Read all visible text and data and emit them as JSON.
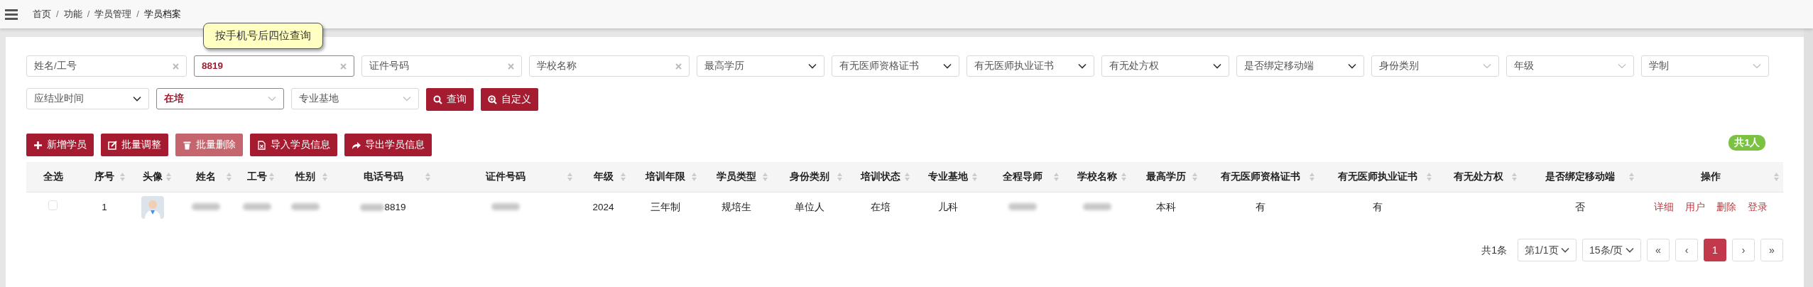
{
  "breadcrumb": [
    {
      "kind": "link",
      "text": "首页"
    },
    {
      "kind": "separator",
      "text": "/"
    },
    {
      "kind": "link",
      "text": "功能"
    },
    {
      "kind": "separator",
      "text": "/"
    },
    {
      "kind": "link",
      "text": "学员管理"
    },
    {
      "kind": "separator",
      "text": "/"
    },
    {
      "kind": "current",
      "text": "学员档案"
    }
  ],
  "tooltip": "按手机号后四位查询",
  "filters": [
    {
      "kind": "text",
      "placeholder": "姓名/工号"
    },
    {
      "kind": "text",
      "value": "8819"
    },
    {
      "kind": "text",
      "placeholder": "证件号码"
    },
    {
      "kind": "text",
      "placeholder": "学校名称"
    },
    {
      "kind": "select",
      "text": "最高学历"
    },
    {
      "kind": "select",
      "text": "有无医师资格证书"
    },
    {
      "kind": "select",
      "text": "有无医师执业证书"
    },
    {
      "kind": "select",
      "text": "有无处方权"
    },
    {
      "kind": "select",
      "text": "是否绑定移动端"
    },
    {
      "kind": "combo",
      "placeholder": "身份类别"
    },
    {
      "kind": "combo",
      "placeholder": "年级"
    },
    {
      "kind": "combo",
      "placeholder": "学制"
    },
    {
      "kind": "select",
      "text": "应结业时间"
    },
    {
      "kind": "combo",
      "value": "在培"
    },
    {
      "kind": "combo",
      "placeholder": "专业基地"
    },
    {
      "kind": "button",
      "label": "查询"
    },
    {
      "kind": "button",
      "label": "自定义"
    }
  ],
  "actions": [
    {
      "label": "新增学员",
      "disabled": false
    },
    {
      "label": "批量调整",
      "disabled": false
    },
    {
      "label": "批量删除",
      "disabled": true
    },
    {
      "label": "导入学员信息",
      "disabled": false
    },
    {
      "label": "导出学员信息",
      "disabled": false
    }
  ],
  "count_badge": "共1人",
  "table": {
    "columns": [
      {
        "label": "全选",
        "sortable": false
      },
      {
        "label": "序号",
        "sortable": true
      },
      {
        "label": "头像",
        "sortable": true
      },
      {
        "label": "姓名",
        "sortable": true
      },
      {
        "label": "工号",
        "sortable": true
      },
      {
        "label": "性别",
        "sortable": true
      },
      {
        "label": "电话号码",
        "sortable": true
      },
      {
        "label": "证件号码",
        "sortable": true
      },
      {
        "label": "年级",
        "sortable": true
      },
      {
        "label": "培训年限",
        "sortable": true
      },
      {
        "label": "学员类型",
        "sortable": true
      },
      {
        "label": "身份类别",
        "sortable": true
      },
      {
        "label": "培训状态",
        "sortable": true
      },
      {
        "label": "专业基地",
        "sortable": true
      },
      {
        "label": "全程导师",
        "sortable": true
      },
      {
        "label": "学校名称",
        "sortable": true
      },
      {
        "label": "最高学历",
        "sortable": true
      },
      {
        "label": "有无医师资格证书",
        "sortable": true
      },
      {
        "label": "有无医师执业证书",
        "sortable": true
      },
      {
        "label": "有无处方权",
        "sortable": true
      },
      {
        "label": "是否绑定移动端",
        "sortable": true
      },
      {
        "label": "操作",
        "sortable": true
      }
    ],
    "rows": [
      {
        "cells": [
          {
            "kind": "checkbox",
            "checked": false
          },
          {
            "kind": "text",
            "text": "1"
          },
          {
            "kind": "avatar"
          },
          {
            "kind": "redacted"
          },
          {
            "kind": "redacted"
          },
          {
            "kind": "redacted"
          },
          {
            "kind": "masked",
            "text": "8819"
          },
          {
            "kind": "redacted"
          },
          {
            "kind": "text",
            "text": "2024"
          },
          {
            "kind": "text",
            "text": "三年制"
          },
          {
            "kind": "text",
            "text": "规培生"
          },
          {
            "kind": "text",
            "text": "单位人"
          },
          {
            "kind": "text",
            "text": "在培"
          },
          {
            "kind": "text",
            "text": "儿科"
          },
          {
            "kind": "redacted"
          },
          {
            "kind": "redacted"
          },
          {
            "kind": "text",
            "text": "本科"
          },
          {
            "kind": "text",
            "text": "有"
          },
          {
            "kind": "text",
            "text": "有"
          },
          null,
          {
            "kind": "text",
            "text": "否"
          },
          {
            "kind": "links",
            "links": [
              "详细",
              "用户",
              "删除",
              "登录"
            ]
          }
        ]
      }
    ]
  },
  "pagination": {
    "total": "共1条",
    "page_select": "第1/1页",
    "size_select": "15条/页",
    "buttons": [
      {
        "label": "«",
        "selected": false
      },
      {
        "label": "‹",
        "selected": false
      },
      {
        "label": "1",
        "selected": true
      },
      {
        "label": "›",
        "selected": false
      },
      {
        "label": "»",
        "selected": false
      }
    ]
  }
}
